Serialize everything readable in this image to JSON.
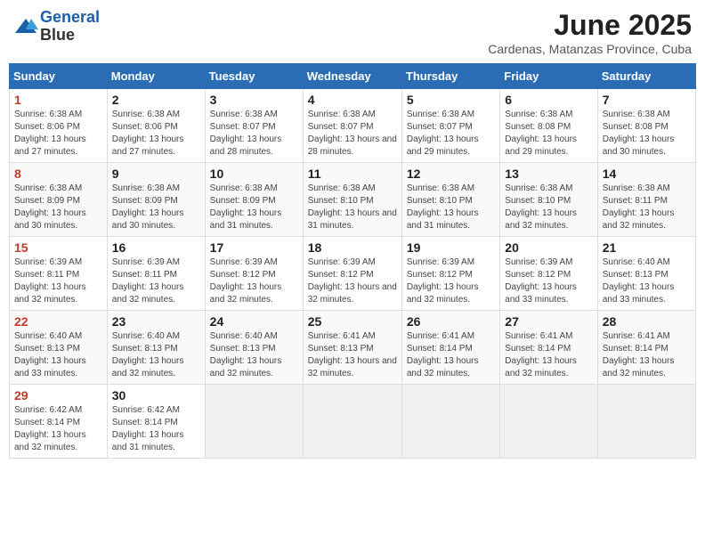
{
  "header": {
    "logo_line1": "General",
    "logo_line2": "Blue",
    "month_title": "June 2025",
    "subtitle": "Cardenas, Matanzas Province, Cuba"
  },
  "weekdays": [
    "Sunday",
    "Monday",
    "Tuesday",
    "Wednesday",
    "Thursday",
    "Friday",
    "Saturday"
  ],
  "weeks": [
    [
      {
        "day": "1",
        "sunrise": "6:38 AM",
        "sunset": "8:06 PM",
        "daylight": "13 hours and 27 minutes."
      },
      {
        "day": "2",
        "sunrise": "6:38 AM",
        "sunset": "8:06 PM",
        "daylight": "13 hours and 27 minutes."
      },
      {
        "day": "3",
        "sunrise": "6:38 AM",
        "sunset": "8:07 PM",
        "daylight": "13 hours and 28 minutes."
      },
      {
        "day": "4",
        "sunrise": "6:38 AM",
        "sunset": "8:07 PM",
        "daylight": "13 hours and 28 minutes."
      },
      {
        "day": "5",
        "sunrise": "6:38 AM",
        "sunset": "8:07 PM",
        "daylight": "13 hours and 29 minutes."
      },
      {
        "day": "6",
        "sunrise": "6:38 AM",
        "sunset": "8:08 PM",
        "daylight": "13 hours and 29 minutes."
      },
      {
        "day": "7",
        "sunrise": "6:38 AM",
        "sunset": "8:08 PM",
        "daylight": "13 hours and 30 minutes."
      }
    ],
    [
      {
        "day": "8",
        "sunrise": "6:38 AM",
        "sunset": "8:09 PM",
        "daylight": "13 hours and 30 minutes."
      },
      {
        "day": "9",
        "sunrise": "6:38 AM",
        "sunset": "8:09 PM",
        "daylight": "13 hours and 30 minutes."
      },
      {
        "day": "10",
        "sunrise": "6:38 AM",
        "sunset": "8:09 PM",
        "daylight": "13 hours and 31 minutes."
      },
      {
        "day": "11",
        "sunrise": "6:38 AM",
        "sunset": "8:10 PM",
        "daylight": "13 hours and 31 minutes."
      },
      {
        "day": "12",
        "sunrise": "6:38 AM",
        "sunset": "8:10 PM",
        "daylight": "13 hours and 31 minutes."
      },
      {
        "day": "13",
        "sunrise": "6:38 AM",
        "sunset": "8:10 PM",
        "daylight": "13 hours and 32 minutes."
      },
      {
        "day": "14",
        "sunrise": "6:38 AM",
        "sunset": "8:11 PM",
        "daylight": "13 hours and 32 minutes."
      }
    ],
    [
      {
        "day": "15",
        "sunrise": "6:39 AM",
        "sunset": "8:11 PM",
        "daylight": "13 hours and 32 minutes."
      },
      {
        "day": "16",
        "sunrise": "6:39 AM",
        "sunset": "8:11 PM",
        "daylight": "13 hours and 32 minutes."
      },
      {
        "day": "17",
        "sunrise": "6:39 AM",
        "sunset": "8:12 PM",
        "daylight": "13 hours and 32 minutes."
      },
      {
        "day": "18",
        "sunrise": "6:39 AM",
        "sunset": "8:12 PM",
        "daylight": "13 hours and 32 minutes."
      },
      {
        "day": "19",
        "sunrise": "6:39 AM",
        "sunset": "8:12 PM",
        "daylight": "13 hours and 32 minutes."
      },
      {
        "day": "20",
        "sunrise": "6:39 AM",
        "sunset": "8:12 PM",
        "daylight": "13 hours and 33 minutes."
      },
      {
        "day": "21",
        "sunrise": "6:40 AM",
        "sunset": "8:13 PM",
        "daylight": "13 hours and 33 minutes."
      }
    ],
    [
      {
        "day": "22",
        "sunrise": "6:40 AM",
        "sunset": "8:13 PM",
        "daylight": "13 hours and 33 minutes."
      },
      {
        "day": "23",
        "sunrise": "6:40 AM",
        "sunset": "8:13 PM",
        "daylight": "13 hours and 32 minutes."
      },
      {
        "day": "24",
        "sunrise": "6:40 AM",
        "sunset": "8:13 PM",
        "daylight": "13 hours and 32 minutes."
      },
      {
        "day": "25",
        "sunrise": "6:41 AM",
        "sunset": "8:13 PM",
        "daylight": "13 hours and 32 minutes."
      },
      {
        "day": "26",
        "sunrise": "6:41 AM",
        "sunset": "8:14 PM",
        "daylight": "13 hours and 32 minutes."
      },
      {
        "day": "27",
        "sunrise": "6:41 AM",
        "sunset": "8:14 PM",
        "daylight": "13 hours and 32 minutes."
      },
      {
        "day": "28",
        "sunrise": "6:41 AM",
        "sunset": "8:14 PM",
        "daylight": "13 hours and 32 minutes."
      }
    ],
    [
      {
        "day": "29",
        "sunrise": "6:42 AM",
        "sunset": "8:14 PM",
        "daylight": "13 hours and 32 minutes."
      },
      {
        "day": "30",
        "sunrise": "6:42 AM",
        "sunset": "8:14 PM",
        "daylight": "13 hours and 31 minutes."
      },
      null,
      null,
      null,
      null,
      null
    ]
  ]
}
